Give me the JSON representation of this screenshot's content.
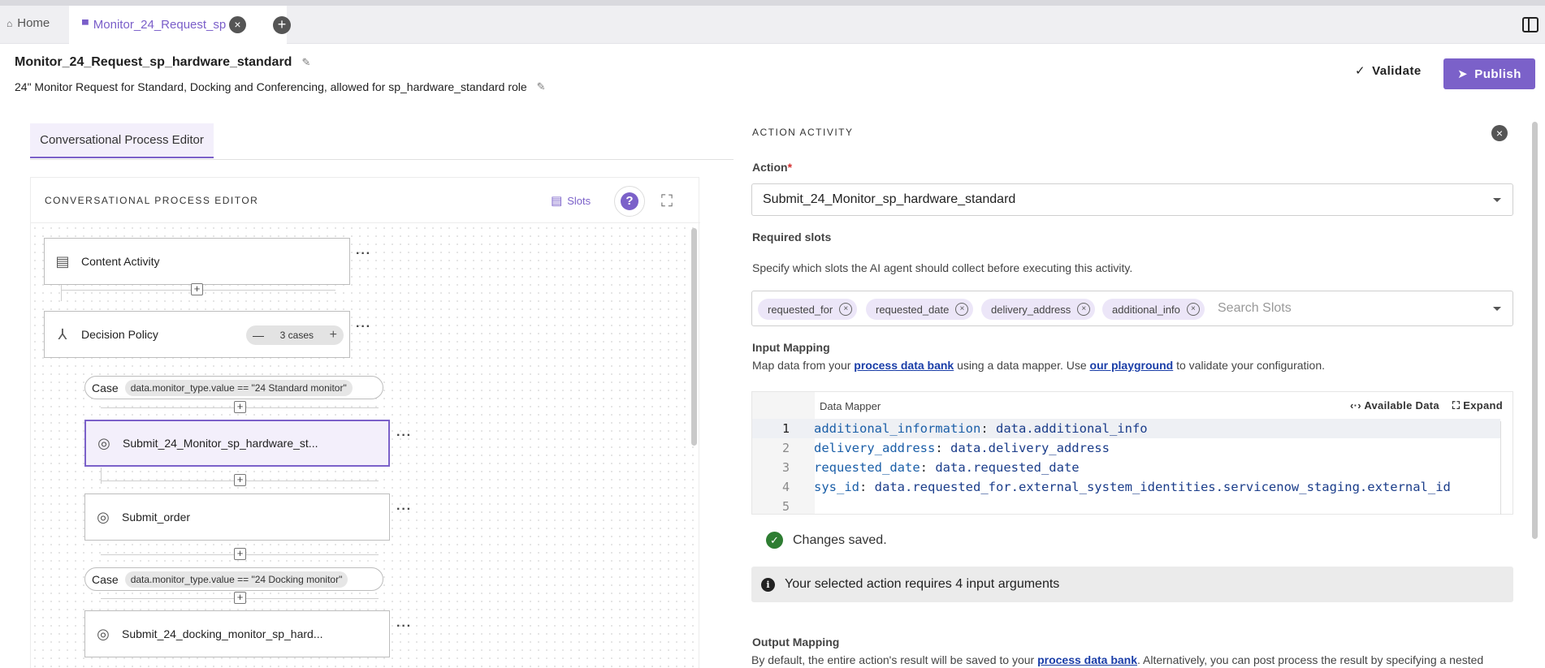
{
  "tabs": {
    "home_label": "Home",
    "active_label": "Monitor_24_Request_sp"
  },
  "header": {
    "title": "Monitor_24_Request_sp_hardware_standard",
    "subtitle": "24\" Monitor Request for Standard, Docking and Conferencing, allowed for sp_hardware_standard role",
    "validate_label": "Validate",
    "publish_label": "Publish"
  },
  "left": {
    "tab_label": "Conversational Process Editor",
    "editor_title": "CONVERSATIONAL PROCESS EDITOR",
    "slots_label": "Slots",
    "help_label": "?",
    "nodes": {
      "content_activity": "Content Activity",
      "decision_policy": "Decision Policy",
      "cases_count": "3 cases",
      "case_word": "Case",
      "case1_expr": "data.monitor_type.value == \"24 Standard monitor\"",
      "submit_standard": "Submit_24_Monitor_sp_hardware_st...",
      "submit_order": "Submit_order",
      "case2_expr": "data.monitor_type.value == \"24 Docking monitor\"",
      "submit_docking": "Submit_24_docking_monitor_sp_hard..."
    }
  },
  "right": {
    "title": "ACTION ACTIVITY",
    "action_label": "Action",
    "action_required_mark": "*",
    "action_value": "Submit_24_Monitor_sp_hardware_standard",
    "required_slots_label": "Required slots",
    "required_slots_desc": "Specify which slots the AI agent should collect before executing this activity.",
    "slot_chips": [
      "requested_for",
      "requested_date",
      "delivery_address",
      "additional_info"
    ],
    "slot_search_placeholder": "Search Slots",
    "input_mapping_label": "Input Mapping",
    "input_mapping_desc_pre": "Map data from your ",
    "input_mapping_link1": "process data bank",
    "input_mapping_desc_mid": " using a data mapper. Use ",
    "input_mapping_link2": "our playground",
    "input_mapping_desc_post": " to validate your configuration.",
    "mapper_title": "Data Mapper",
    "available_data_label": "Available Data",
    "expand_label": "Expand",
    "code_lines": [
      {
        "num": "1",
        "key": "additional_information",
        "val": "data.additional_info"
      },
      {
        "num": "2",
        "key": "delivery_address",
        "val": "data.delivery_address"
      },
      {
        "num": "3",
        "key": "requested_date",
        "val": "data.requested_date"
      },
      {
        "num": "4",
        "key": "sys_id",
        "val": "data.requested_for.external_system_identities.servicenow_staging.external_id"
      },
      {
        "num": "5",
        "key": "",
        "val": ""
      }
    ],
    "saved_message": "Changes saved.",
    "info_message": "Your selected action requires 4 input arguments",
    "output_mapping_label": "Output Mapping",
    "output_desc_pre": "By default, the entire action's result will be saved to your ",
    "output_desc_link": "process data bank",
    "output_desc_post": ". Alternatively, you can post process the result by specifying a nested"
  },
  "colors": {
    "accent": "#7b61c9",
    "accent_light": "#f3effb",
    "link": "#1a3ea8",
    "success": "#2e7d32"
  }
}
